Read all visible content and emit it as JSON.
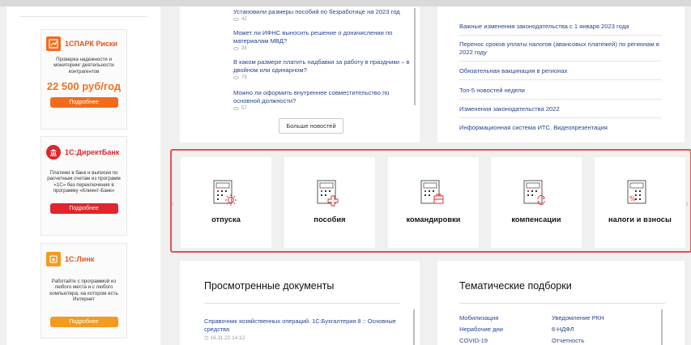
{
  "sidebar": {
    "ads": [
      {
        "logo": "1СПАРК Риски",
        "text": "Проверка надежности и мониторинг деятельности контрагентов",
        "price": "22 500 руб/год",
        "button": "Подробнее",
        "color": "#f26b1d"
      },
      {
        "logo": "1С:ДиректБанк",
        "text": "Платежи в банк и выписки по расчетным счетам из программ «1С» без переключения в программу «Клиент-Банк»",
        "button": "Подробнее",
        "color": "#e0262c"
      },
      {
        "logo": "1С:Линк",
        "text": "Работайте с программой из любого места и с любого компьютера, на котором есть Интернет",
        "button": "Подробнее",
        "color": "#f39a1f"
      }
    ]
  },
  "news": {
    "items": [
      {
        "title": "Установили размеры пособий по безработице на 2023 год",
        "views": "42"
      },
      {
        "title": "Может ли ИФНС выносить решение о доначислении по материалам МВД?",
        "views": "38"
      },
      {
        "title": "В каком размере платить надбавки за работу в праздники – в двойном или одинарном?",
        "views": "79"
      },
      {
        "title": "Можно ли оформить внутреннее совместительство по основной должности?",
        "views": "57"
      }
    ],
    "more_button": "Больше новостей"
  },
  "right_links": [
    "Важные изменения законодательства с 1 января 2023 года",
    "Перенос сроков уплаты налогов (авансовых платежей) по регионам в 2022 году",
    "Обязательная вакцинация в регионах",
    "Топ-5 новостей недели",
    "Изменения законодательства 2022",
    "Информационная система ИТС. Видеопрезентация"
  ],
  "calculators": [
    {
      "label": "отпуска",
      "icon": "sun-icon"
    },
    {
      "label": "пособия",
      "icon": "cross-icon"
    },
    {
      "label": "командировки",
      "icon": "suitcase-icon"
    },
    {
      "label": "компенсации",
      "icon": "refresh-icon"
    },
    {
      "label": "налоги и взносы",
      "icon": "percent-icon"
    }
  ],
  "viewed": {
    "title": "Просмотренные документы",
    "doc_title": "Справочник хозяйственных операций. 1С:Бухгалтерия 8 :: Основные средства",
    "doc_date": "18.11.22 14:12"
  },
  "themed": {
    "title": "Тематические подборки",
    "col1": [
      "Мобилизация",
      "Нерабочие дни",
      "COVID-19"
    ],
    "col2": [
      "Уведомление РКН",
      "6-НДФЛ",
      "Отчетность"
    ]
  },
  "accent": "#e05353"
}
